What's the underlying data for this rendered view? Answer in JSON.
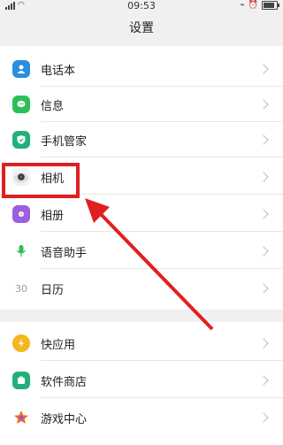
{
  "status_bar": {
    "time": "09:53"
  },
  "title": "设置",
  "group1": [
    {
      "label": "电话本",
      "icon": "contacts-icon",
      "color": "#2a8de0"
    },
    {
      "label": "信息",
      "icon": "messages-icon",
      "color": "#2fbf5a"
    },
    {
      "label": "手机管家",
      "icon": "phone-manager-icon",
      "color": "#22b07a"
    },
    {
      "label": "相机",
      "icon": "camera-icon",
      "color": "#444444"
    },
    {
      "label": "相册",
      "icon": "gallery-icon",
      "color": "#9b5fe0"
    },
    {
      "label": "语音助手",
      "icon": "voice-assistant-icon",
      "color": "#2fbf5a"
    },
    {
      "label": "日历",
      "icon": "calendar-icon",
      "color": "#e25050",
      "icon_text": "30"
    }
  ],
  "group2": [
    {
      "label": "快应用",
      "icon": "quick-app-icon",
      "color": "#f5b71c"
    },
    {
      "label": "软件商店",
      "icon": "app-store-icon",
      "color": "#22b07a"
    },
    {
      "label": "游戏中心",
      "icon": "game-center-icon",
      "color": "#f06a2a"
    }
  ],
  "annotation": {
    "highlight_color": "#e02020"
  }
}
